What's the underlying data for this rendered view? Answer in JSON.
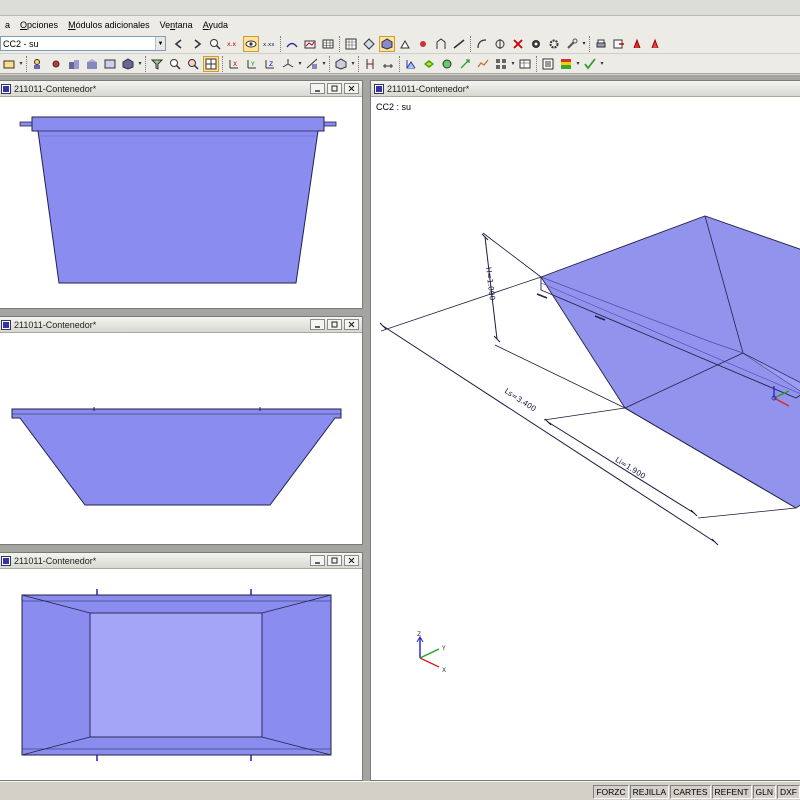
{
  "menu": {
    "items": [
      {
        "pre": "",
        "ul": "",
        "post": "a"
      },
      {
        "pre": "",
        "ul": "O",
        "post": "pciones"
      },
      {
        "pre": "",
        "ul": "M",
        "post": "ódulos adicionales"
      },
      {
        "pre": "Ve",
        "ul": "n",
        "post": "tana"
      },
      {
        "pre": "",
        "ul": "A",
        "post": "yuda"
      }
    ]
  },
  "toolbar": {
    "load_case_value": "CC2 - su"
  },
  "windows": {
    "front": {
      "title": "211011-Contenedor*"
    },
    "side": {
      "title": "211011-Contenedor*"
    },
    "top": {
      "title": "211011-Contenedor*"
    },
    "iso": {
      "title": "211011-Contenedor*",
      "load_case": "CC2 : su"
    }
  },
  "dimensions": {
    "height": "H=1.000",
    "top_length": "Ls=3.400",
    "bottom_length": "Li=1.900"
  },
  "axes": {
    "x": "X",
    "y": "Y",
    "z": "Z"
  },
  "status_tabs": [
    "FORZC",
    "REJILLA",
    "CARTES",
    "REFENT",
    "GLN",
    "DXF"
  ],
  "colors": {
    "container_fill": "#8b8cf0",
    "container_stroke": "#22224a",
    "dimension_line": "#1a1a40",
    "axis_x": "#e02020",
    "axis_y": "#20a020",
    "axis_z": "#2020d0"
  }
}
